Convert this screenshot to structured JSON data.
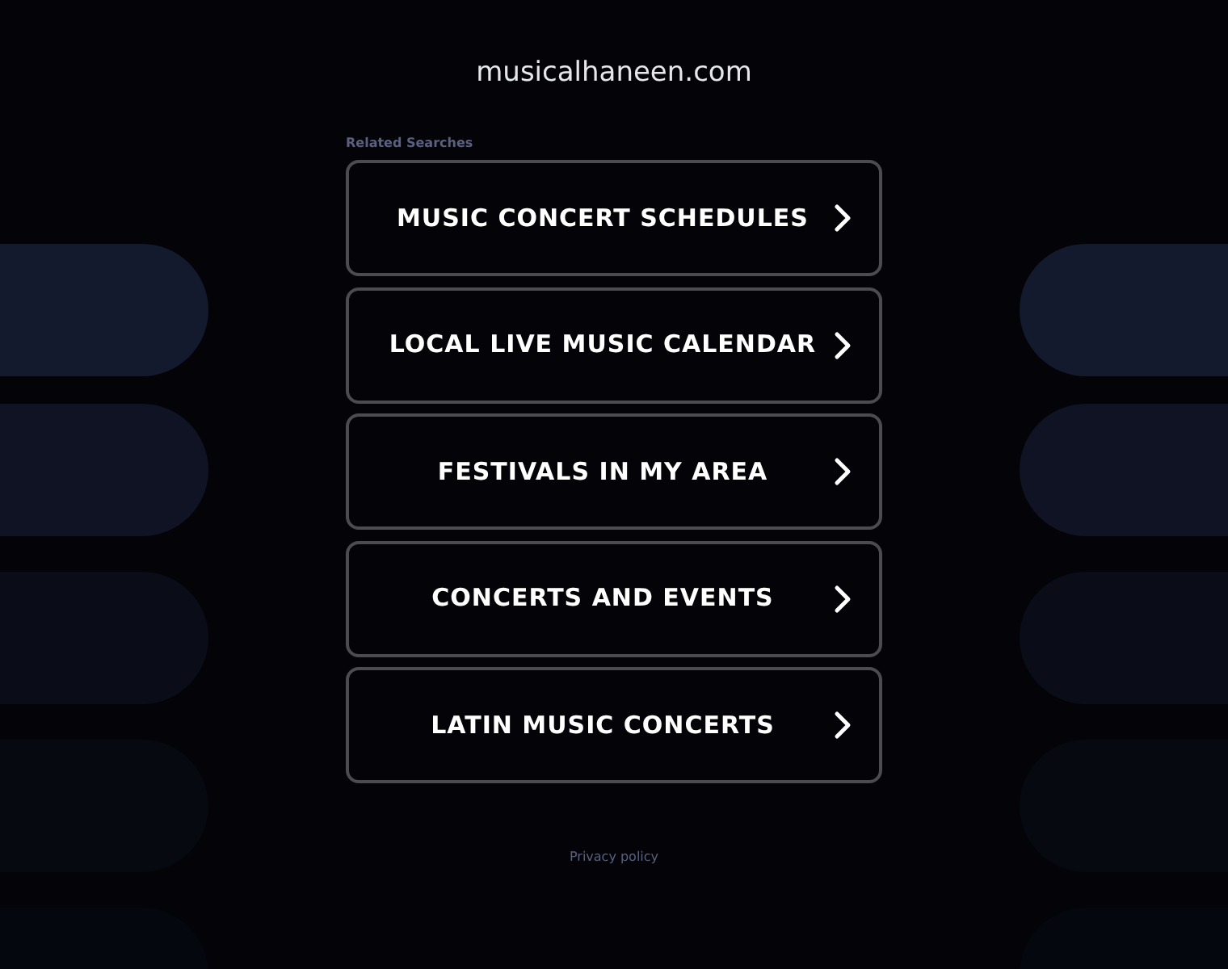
{
  "site": {
    "domain": "musicalhaneen.com"
  },
  "related": {
    "heading": "Related Searches",
    "links": [
      {
        "label": "MUSIC CONCERT SCHEDULES"
      },
      {
        "label": "LOCAL LIVE MUSIC CALENDAR"
      },
      {
        "label": "FESTIVALS IN MY AREA"
      },
      {
        "label": "CONCERTS AND EVENTS"
      },
      {
        "label": "LATIN MUSIC CONCERTS"
      }
    ]
  },
  "footer": {
    "privacy": "Privacy policy"
  }
}
